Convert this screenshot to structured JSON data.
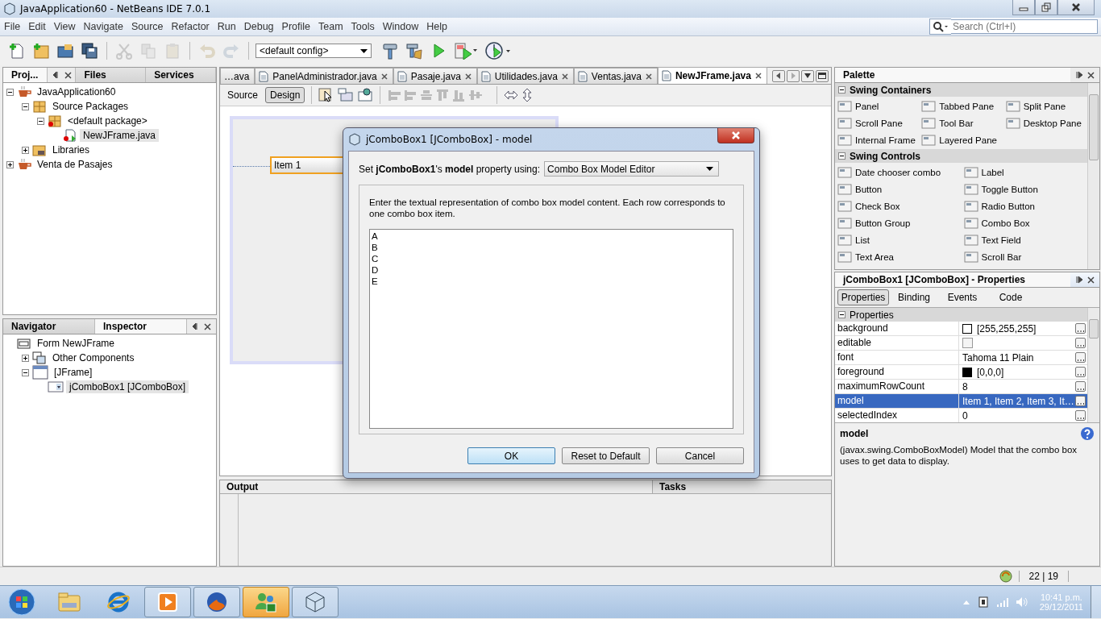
{
  "window": {
    "title": "JavaApplication60 - NetBeans IDE 7.0.1"
  },
  "menu": [
    "File",
    "Edit",
    "View",
    "Navigate",
    "Source",
    "Refactor",
    "Run",
    "Debug",
    "Profile",
    "Team",
    "Tools",
    "Window",
    "Help"
  ],
  "search": {
    "placeholder": "Search (Ctrl+I)"
  },
  "toolbar": {
    "buttons": [
      {
        "kind": "new-file",
        "disabled": false
      },
      {
        "kind": "new-project",
        "disabled": false
      },
      {
        "kind": "open",
        "disabled": false
      },
      {
        "kind": "save",
        "disabled": false
      },
      {
        "kind": "cut",
        "disabled": true
      },
      {
        "kind": "copy",
        "disabled": true
      },
      {
        "kind": "paste",
        "disabled": true
      },
      {
        "kind": "undo",
        "disabled": true
      },
      {
        "kind": "redo",
        "disabled": true
      }
    ],
    "config": "<default config>"
  },
  "projects_panel": {
    "tabs": [
      {
        "label": "Proj...",
        "selected": true
      },
      {
        "label": "Files",
        "selected": false
      },
      {
        "label": "Services",
        "selected": false
      }
    ],
    "tree": [
      {
        "label": "JavaApplication60",
        "kind": "project",
        "expanded": true,
        "selected": false,
        "children": [
          {
            "label": "Source Packages",
            "kind": "packages",
            "expanded": true,
            "selected": false,
            "children": [
              {
                "label": "<default package>",
                "kind": "package",
                "expanded": true,
                "selected": false,
                "children": [
                  {
                    "label": "NewJFrame.java",
                    "kind": "file",
                    "selected": true
                  }
                ]
              }
            ]
          },
          {
            "label": "Libraries",
            "kind": "libraries",
            "expanded": false,
            "selected": false
          }
        ]
      },
      {
        "label": "Venta de Pasajes",
        "kind": "project",
        "expanded": false,
        "selected": false
      }
    ]
  },
  "navigator_panel": {
    "tabs": [
      {
        "label": "Navigator",
        "selected": false
      },
      {
        "label": "Inspector",
        "selected": true
      }
    ],
    "tree": [
      {
        "label": "Form NewJFrame",
        "kind": "form",
        "selected": false,
        "children": [
          {
            "label": "Other Components",
            "kind": "components",
            "expanded": false,
            "selected": false
          },
          {
            "label": "[JFrame]",
            "kind": "frame",
            "expanded": true,
            "selected": false,
            "children": [
              {
                "label": "jComboBox1 [JComboBox]",
                "kind": "combo",
                "selected": true
              }
            ]
          }
        ]
      }
    ]
  },
  "editor": {
    "tabs": [
      {
        "label": "…ava",
        "selected": false
      },
      {
        "label": "PanelAdministrador.java",
        "selected": false
      },
      {
        "label": "Pasaje.java",
        "selected": false
      },
      {
        "label": "Utilidades.java",
        "selected": false
      },
      {
        "label": "Ventas.java",
        "selected": false
      },
      {
        "label": "NewJFrame.java",
        "selected": true
      }
    ],
    "modes": [
      {
        "label": "Source",
        "selected": false
      },
      {
        "label": "Design",
        "selected": true
      }
    ],
    "combo_value": "Item 1"
  },
  "bottom_panel": {
    "tabs": [
      {
        "label": "Output",
        "selected": true
      },
      {
        "label": "Tasks",
        "selected": false
      }
    ]
  },
  "palette": {
    "title": "Palette",
    "sections": [
      {
        "title": "Swing Containers",
        "expanded": true,
        "items": [
          "Panel",
          "Tabbed Pane",
          "Split Pane",
          "Scroll Pane",
          "Tool Bar",
          "Desktop Pane",
          "Internal Frame",
          "Layered Pane"
        ]
      },
      {
        "title": "Swing Controls",
        "expanded": true,
        "items": [
          "Date chooser combo",
          "Label",
          "Button",
          "Toggle Button",
          "Check Box",
          "Radio Button",
          "Button Group",
          "Combo Box",
          "List",
          "Text Field",
          "Text Area",
          "Scroll Bar"
        ]
      }
    ]
  },
  "properties": {
    "title": "jComboBox1 [JComboBox] - Properties",
    "tabs": [
      {
        "label": "Properties",
        "selected": true
      },
      {
        "label": "Binding",
        "selected": false
      },
      {
        "label": "Events",
        "selected": false
      },
      {
        "label": "Code",
        "selected": false
      }
    ],
    "section": "Properties",
    "rows": [
      {
        "name": "background",
        "kind": "color",
        "color": "#ffffff",
        "value": "[255,255,255]",
        "selected": false
      },
      {
        "name": "editable",
        "kind": "checkbox",
        "checked": false,
        "selected": false
      },
      {
        "name": "font",
        "kind": "text",
        "value": "Tahoma 11 Plain",
        "selected": false
      },
      {
        "name": "foreground",
        "kind": "color",
        "color": "#000000",
        "value": "[0,0,0]",
        "selected": false
      },
      {
        "name": "maximumRowCount",
        "kind": "text",
        "value": "8",
        "selected": false
      },
      {
        "name": "model",
        "kind": "text",
        "value": "Item 1, Item 2, Item 3, It…",
        "selected": true
      },
      {
        "name": "selectedIndex",
        "kind": "text",
        "value": "0",
        "selected": false
      }
    ],
    "help_title": "model",
    "help_text": "(javax.swing.ComboBoxModel) Model that the combo box uses to get data to display."
  },
  "dialog": {
    "title": "jComboBox1 [JComboBox] - model",
    "prompt": "Set **jComboBox1**'s **model** property using:",
    "editor": "Combo Box Model Editor",
    "instruction": "Enter the textual representation of combo box model content. Each row corresponds to one combo box item.",
    "content": "A\nB\nC\nD\nE",
    "buttons": [
      {
        "label": "OK",
        "default": true
      },
      {
        "label": "Reset to Default",
        "default": false
      },
      {
        "label": "Cancel",
        "default": false
      }
    ]
  },
  "status_bar": {
    "position": "22 | 19"
  },
  "taskbar": {
    "apps": [
      {
        "kind": "explorer",
        "active": false
      },
      {
        "kind": "browser",
        "active": false
      },
      {
        "kind": "media",
        "active": false
      },
      {
        "kind": "firefox",
        "active": false
      },
      {
        "kind": "messenger",
        "active": true
      },
      {
        "kind": "netbeans",
        "active": false
      }
    ],
    "time": "10:41 p.m.",
    "date": "29/12/2011"
  }
}
